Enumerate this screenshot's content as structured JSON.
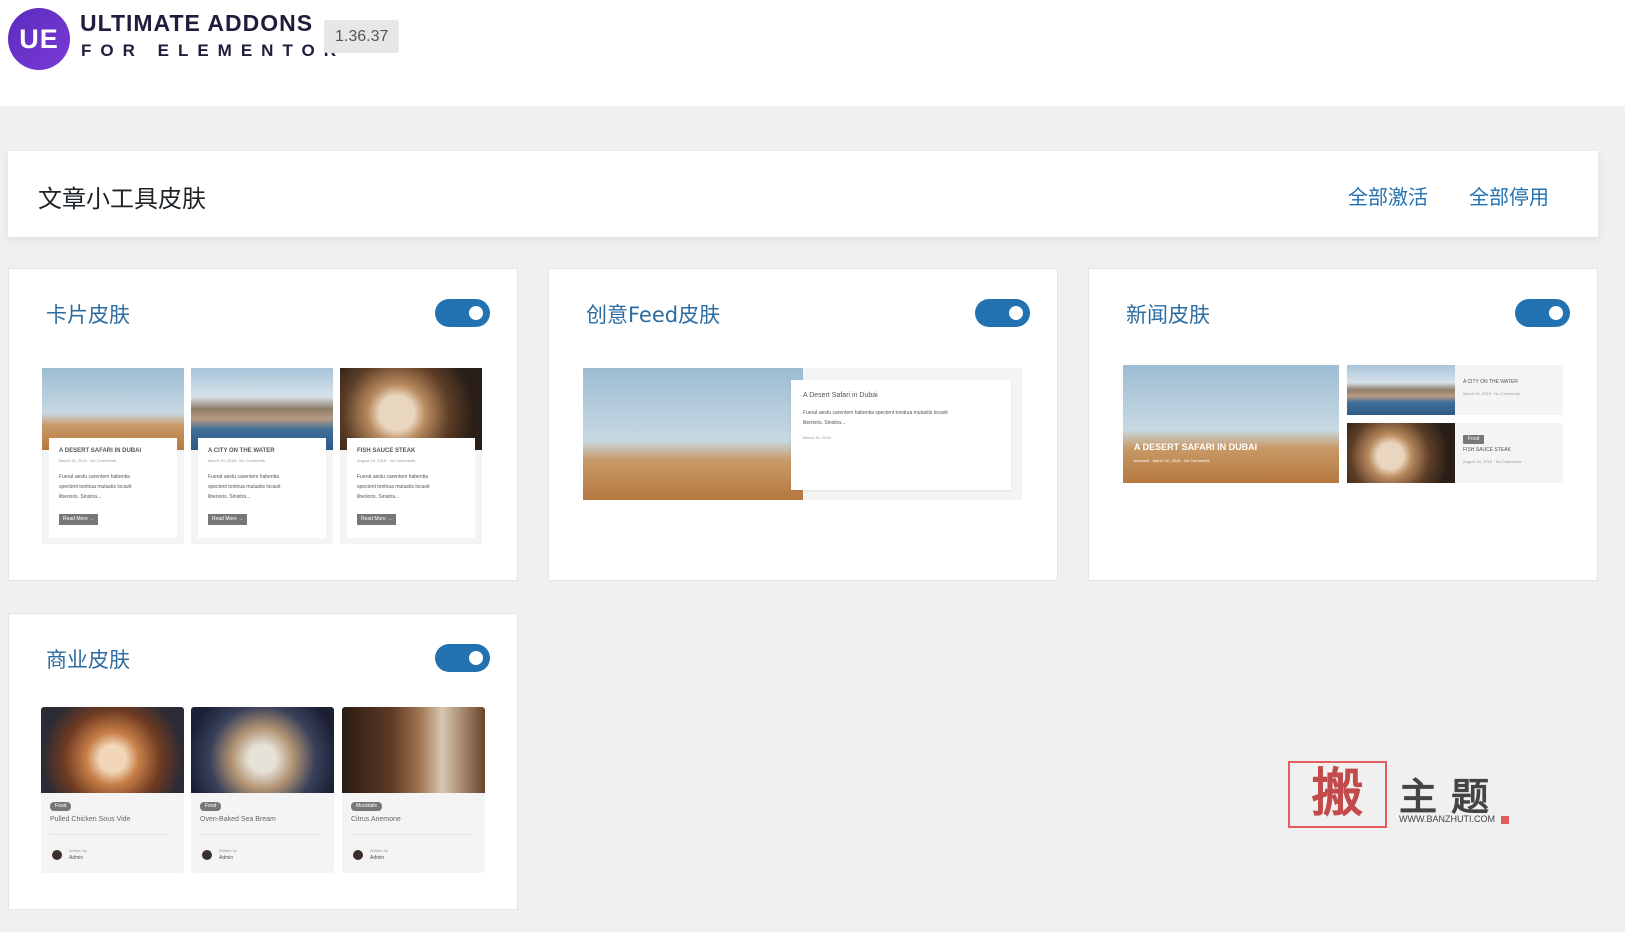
{
  "header": {
    "logo_text": "UE",
    "brand_line1": "ULTIMATE ADDONS",
    "brand_line2": "FOR ELEMENTOR",
    "version": "1.36.37"
  },
  "section": {
    "title": "文章小工具皮肤",
    "activate_all": "全部激活",
    "deactivate_all": "全部停用"
  },
  "skins": [
    {
      "title": "卡片皮肤",
      "enabled": true,
      "preview": {
        "items": [
          {
            "title": "A DESERT SAFARI IN DUBAI",
            "meta": "March 30, 2018  ·  No Comments",
            "excerpt1": "Fuerat aestu carentem habentia",
            "excerpt2": "spectent tonitrua mutastis locavit",
            "excerpt3": "liberioris. Sinistra...",
            "button": "Read More →"
          },
          {
            "title": "A CITY ON THE WATER",
            "meta": "March 30, 2018  ·  No Comments",
            "excerpt1": "Fuerat aestu carentem habentia",
            "excerpt2": "spectent tonitrua mutastis locavit",
            "excerpt3": "liberioris. Sinistra...",
            "button": "Read More →"
          },
          {
            "title": "FISH SAUCE STEAK",
            "meta": "August 16, 2018  ·  No Comments",
            "excerpt1": "Fuerat aestu carentem habentia",
            "excerpt2": "spectent tonitrua mutastis locavit",
            "excerpt3": "liberioris. Sinistra...",
            "button": "Read More →"
          }
        ]
      }
    },
    {
      "title": "创意Feed皮肤",
      "enabled": true,
      "preview": {
        "title": "A Desert Safari in Dubai",
        "excerpt1": "Fuerat aestu carentem habentia spectent tonitrua mutastis locavit",
        "excerpt2": "liberioris. Sinistra...",
        "meta": "March 30, 2018"
      }
    },
    {
      "title": "新闻皮肤",
      "enabled": true,
      "preview": {
        "feature_title": "A DESERT SAFARI IN DUBAI",
        "feature_meta": "banzhuti  ·  March 30, 2018  ·  No Comments",
        "side": [
          {
            "title": "A CITY ON THE WATER",
            "meta": "March 30, 2018  ·  No Comments",
            "tag": ""
          },
          {
            "title": "FISH SAUCE STEAK",
            "meta": "August 16, 2018  ·  No Comments",
            "tag": "Food"
          }
        ]
      }
    },
    {
      "title": "商业皮肤",
      "enabled": true,
      "preview": {
        "items": [
          {
            "tag": "Food",
            "title": "Pulled Chicken Sous Vide",
            "written_by": "Written by",
            "author": "Admin"
          },
          {
            "tag": "Food",
            "title": "Oven-Baked Sea Bream",
            "written_by": "Written by",
            "author": "Admin"
          },
          {
            "tag": "Mocktails",
            "title": "Citrus Anemone",
            "written_by": "Written by",
            "author": "Admin"
          }
        ]
      }
    }
  ],
  "watermark": {
    "box_char": "搬",
    "text": "主题",
    "url": "WWW.BANZHUTI.COM"
  },
  "colors": {
    "accent": "#2271b1",
    "card_title": "#2d6ca2",
    "brand_purple": "#6a34cc"
  }
}
